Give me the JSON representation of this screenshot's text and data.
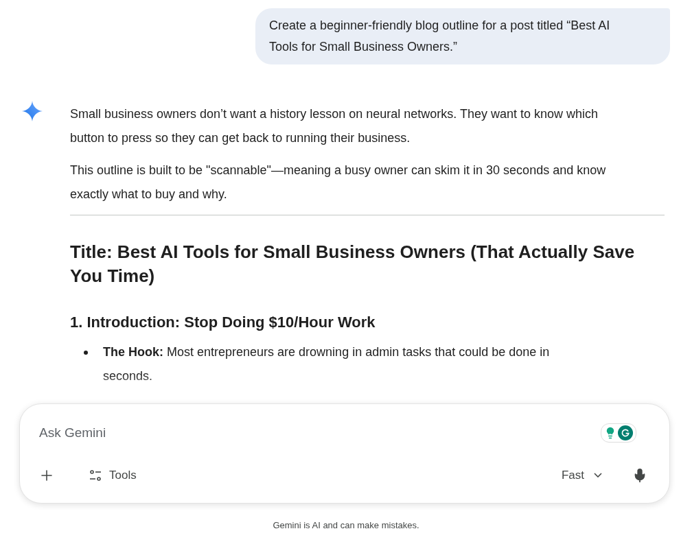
{
  "user_message": {
    "text": "Create a beginner-friendly blog outline for a post titled “Best AI Tools for Small Business Owners.”"
  },
  "response": {
    "paragraphs": [
      "Small business owners don’t want a history lesson on neural networks. They want to know which button to press so they can get back to running their business.",
      "This outline is built to be \"scannable\"—meaning a busy owner can skim it in 30 seconds and know exactly what to buy and why."
    ],
    "title": "Title: Best AI Tools for Small Business Owners (That Actually Save You Time)",
    "sections": [
      {
        "heading": "1. Introduction: Stop Doing $10/Hour Work",
        "bullets": [
          "**The Hook:** Most entrepreneurs are drowning in admin tasks that could be done in seconds."
        ]
      }
    ]
  },
  "composer": {
    "placeholder": "Ask Gemini",
    "tools_label": "Tools",
    "mode": "Fast"
  },
  "disclaimer": "Gemini is AI and can make mistakes."
}
